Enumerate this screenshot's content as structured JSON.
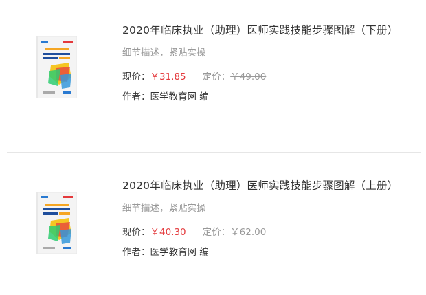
{
  "products": [
    {
      "title": "2020年临床执业（助理）医师实践技能步骤图解（下册）",
      "subtitle": "细节描述，紧贴实操",
      "price_label": "现价：",
      "price": "￥31.85",
      "original_label": "定价：",
      "original_price": "￥49.00",
      "author_label": "作者：",
      "author": "医学教育网 编",
      "cover_icon": "book-cover-image"
    },
    {
      "title": "2020年临床执业（助理）医师实践技能步骤图解（上册）",
      "subtitle": "细节描述，紧贴实操",
      "price_label": "现价：",
      "price": "￥40.30",
      "original_label": "定价：",
      "original_price": "￥62.00",
      "author_label": "作者：",
      "author": "医学教育网 编",
      "cover_icon": "book-cover-image"
    }
  ],
  "colors": {
    "price": "#e4393c",
    "muted": "#999999",
    "text": "#333333",
    "divider": "#e6e6e6"
  }
}
